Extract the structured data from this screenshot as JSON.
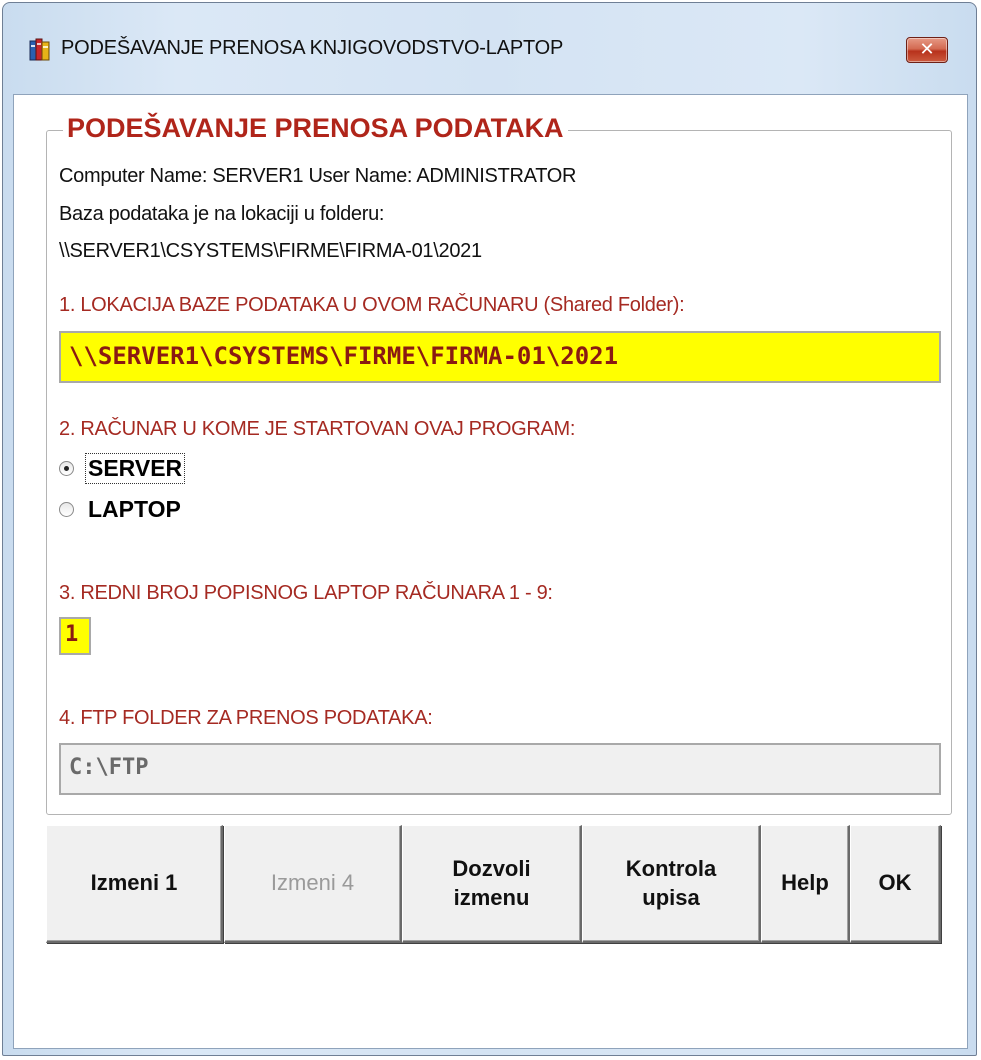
{
  "window": {
    "title": "PODEŠAVANJE PRENOSA KNJIGOVODSTVO-LAPTOP",
    "close_glyph": "✕"
  },
  "group": {
    "title": "PODEŠAVANJE PRENOSA PODATAKA"
  },
  "info": {
    "line1": "Computer Name: SERVER1 User Name: ADMINISTRATOR",
    "line2": "Baza podataka je na lokaciji u folderu:",
    "line3": "\\\\SERVER1\\CSYSTEMS\\FIRME\\FIRMA-01\\2021"
  },
  "section1": {
    "label": "1. LOKACIJA BAZE PODATAKA U OVOM RAČUNARU (Shared Folder):",
    "value": "\\\\SERVER1\\CSYSTEMS\\FIRME\\FIRMA-01\\2021"
  },
  "section2": {
    "label": "2. RAČUNAR U KOME JE STARTOVAN OVAJ PROGRAM:",
    "options": [
      {
        "label": "SERVER",
        "checked": true
      },
      {
        "label": "LAPTOP",
        "checked": false
      }
    ]
  },
  "section3": {
    "label": "3. REDNI BROJ POPISNOG LAPTOP RAČUNARA 1 - 9:",
    "value": "1"
  },
  "section4": {
    "label": "4. FTP FOLDER ZA PRENOS PODATAKA:",
    "value": "C:\\FTP"
  },
  "buttons": {
    "izmeni1": "Izmeni 1",
    "izmeni4": "Izmeni 4",
    "dozvoli": "Dozvoli\nizmenu",
    "kontrola": "Kontrola\nupisa",
    "help": "Help",
    "ok": "OK"
  },
  "colors": {
    "label_red": "#a52a22",
    "field_yellow": "#ffff00",
    "field_text": "#8a1a12"
  }
}
